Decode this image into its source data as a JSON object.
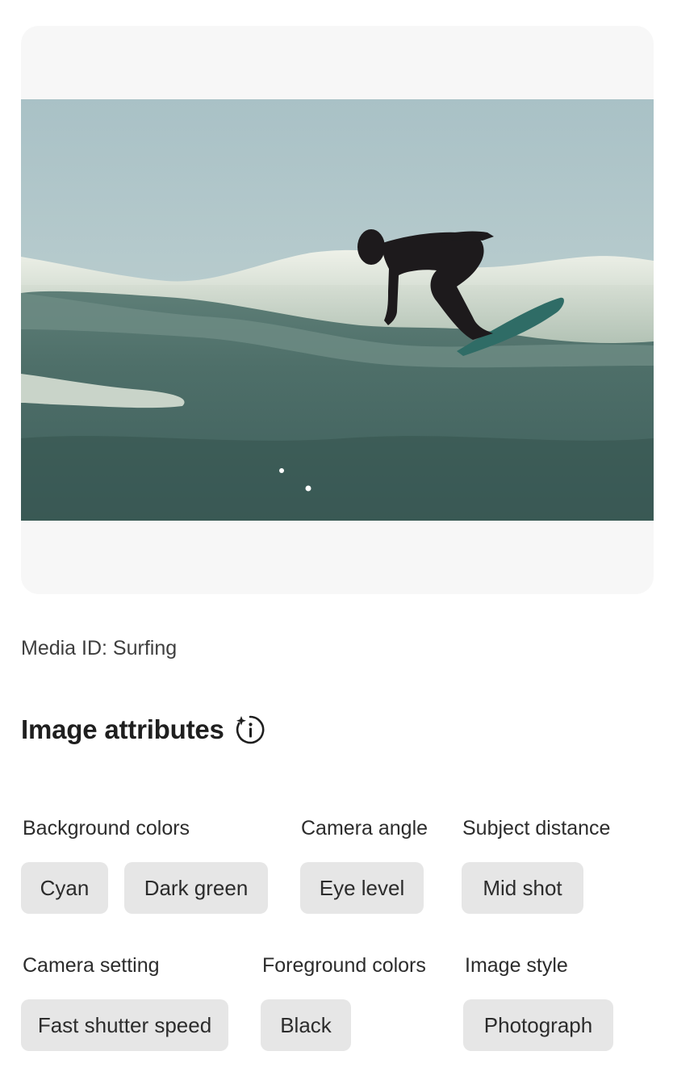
{
  "media": {
    "id_text": "Media ID: Surfing",
    "icon": "photo-surfer-on-wave"
  },
  "attributes": {
    "title": "Image attributes",
    "info_icon": "ai-info-icon",
    "groups": [
      {
        "label": "Background colors",
        "chips": [
          "Cyan",
          "Dark green"
        ]
      },
      {
        "label": "Camera angle",
        "chips": [
          "Eye level"
        ]
      },
      {
        "label": "Subject distance",
        "chips": [
          "Mid shot"
        ]
      },
      {
        "label": "Camera setting",
        "chips": [
          "Fast shutter speed"
        ]
      },
      {
        "label": "Foreground colors",
        "chips": [
          "Black"
        ]
      },
      {
        "label": "Image style",
        "chips": [
          "Photograph"
        ]
      }
    ]
  },
  "colors": {
    "chip_bg": "#e6e6e6",
    "card_bg": "#f7f7f7",
    "text": "#2c2c2c"
  }
}
